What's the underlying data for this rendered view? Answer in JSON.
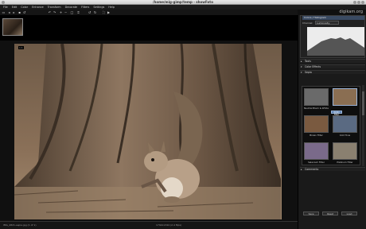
{
  "window": {
    "title": "/home/mig-gimp/temp - showFoto"
  },
  "menu": [
    "File",
    "Edit",
    "Color",
    "Enhance",
    "Transform",
    "Decorate",
    "Filters",
    "Settings",
    "Help"
  ],
  "toolbar": {
    "icons": [
      "folder-open-icon",
      "arrow-left-icon",
      "arrow-right-icon",
      "save-icon",
      "revert-icon",
      "undo-icon",
      "redo-icon",
      "zoom-in-icon",
      "zoom-out-icon",
      "fit-icon",
      "crop-icon",
      "rotate-left-icon",
      "rotate-right-icon",
      "fullscreen-icon",
      "slideshow-icon"
    ]
  },
  "logo": {
    "text": "digikam.org"
  },
  "viewer": {
    "corner_label": "1:1"
  },
  "statusbar": {
    "left": "IMG_4821-sepia.jpg (1 of 1)",
    "center": "1792x1344 (2.4 Mpx)"
  },
  "sidebar": {
    "histogram_title": "Colors / Histogram",
    "channel_label": "Channel:",
    "channel_value": "Luminosity",
    "sections": [
      "Tools",
      "Color Effects",
      "Sepia"
    ],
    "effects": [
      {
        "label": "Neutral Black & White",
        "tint": "#6a6a6a"
      },
      {
        "label": "Sepia",
        "tint": "#8a6e52"
      },
      {
        "label": "Brown Filter",
        "tint": "#7a5a40"
      },
      {
        "label": "Cold Tone",
        "tint": "#5a6a82"
      },
      {
        "label": "Selenium Filter",
        "tint": "#7a6a8a"
      },
      {
        "label": "Platinum Filter",
        "tint": "#8a8070"
      }
    ],
    "apply_label": "Apply Filter",
    "comments_label": "Comments",
    "buttons": [
      "Save",
      "Reset",
      "Load"
    ]
  },
  "colors": {
    "accent": "#3a4a62",
    "sepia": "#a08060"
  }
}
